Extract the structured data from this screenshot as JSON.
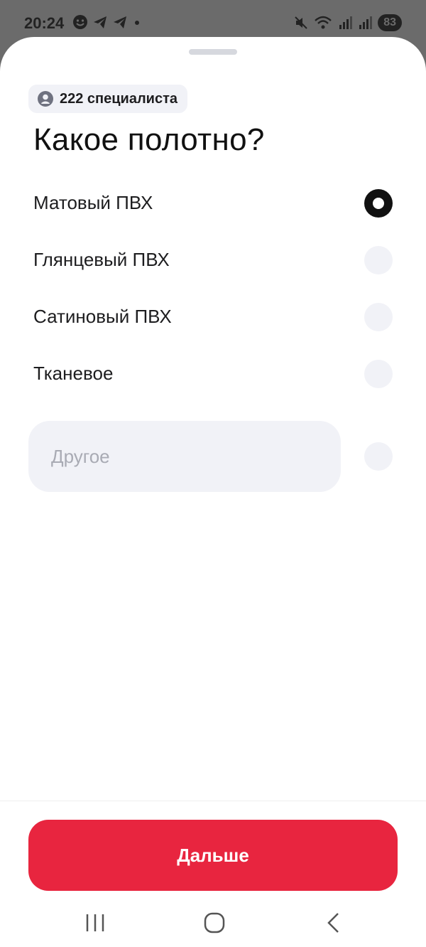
{
  "status_bar": {
    "time": "20:24",
    "battery": "83",
    "left_icons": [
      "emoji-face-icon",
      "telegram-icon",
      "telegram-icon",
      "dot-icon"
    ],
    "right_icons": [
      "mute-icon",
      "wifi-icon",
      "signal-icon",
      "signal-icon"
    ]
  },
  "badge": {
    "icon": "user-icon",
    "text": "222 специалиста"
  },
  "title": "Какое полотно?",
  "options": [
    {
      "label": "Матовый ПВХ",
      "selected": true
    },
    {
      "label": "Глянцевый ПВХ",
      "selected": false
    },
    {
      "label": "Сатиновый ПВХ",
      "selected": false
    },
    {
      "label": "Тканевое",
      "selected": false
    }
  ],
  "other": {
    "placeholder": "Другое",
    "value": "",
    "selected": false
  },
  "next_button": {
    "label": "Дальше"
  },
  "nav_bar": {
    "icons": [
      "recent-apps-icon",
      "home-icon",
      "back-icon"
    ]
  },
  "colors": {
    "accent": "#e8253f",
    "radio_unselected": "#f1f2f7",
    "radio_selected": "#111111",
    "input_bg": "#f1f2f7"
  }
}
